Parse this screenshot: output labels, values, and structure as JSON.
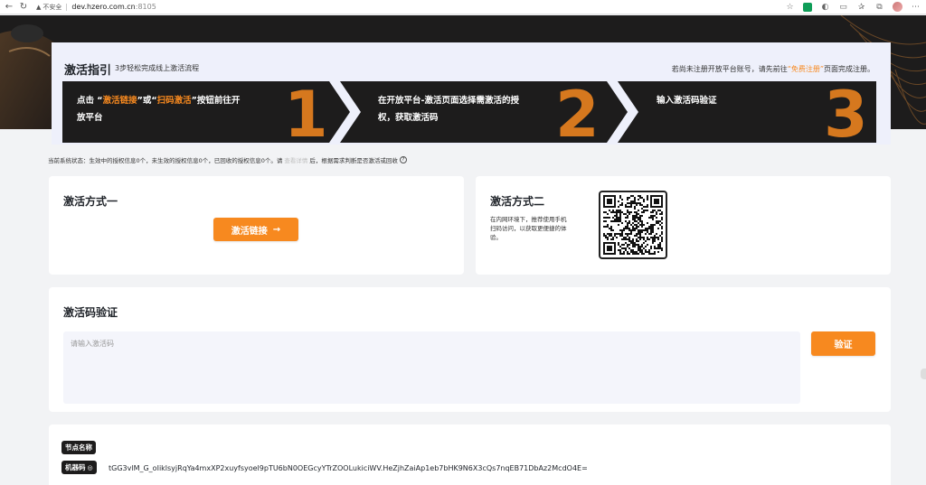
{
  "browser": {
    "security_label": "不安全",
    "url_host": "dev.hzero.com.cn",
    "url_port": ":8105"
  },
  "guide": {
    "title": "激活指引",
    "subtitle": "3步轻松完成线上激活流程",
    "right_prefix": "若尚未注册开放平台账号，请先前往",
    "right_link": "“免费注册”",
    "right_suffix": "页面完成注册。",
    "steps": [
      {
        "pre": "点击 “",
        "hl1": "激活链接",
        "mid": "”或“",
        "hl2": "扫码激活",
        "post": "”按钮前往开",
        "line2": "放平台",
        "number": "1"
      },
      {
        "line1": "在开放平台-激活页面选择需激活的授",
        "line2": "权，获取激活码",
        "number": "2"
      },
      {
        "line1": "输入激活码验证",
        "number": "3"
      }
    ]
  },
  "status": {
    "prefix": "当前系统状态：生效中的授权信息0个，未生效的授权信息0个，已回收的授权信息0个。请",
    "link": "查看详情",
    "suffix": "后，根据需求判断是否激活或回收"
  },
  "method1": {
    "title": "激活方式一",
    "button": "激活链接",
    "button_arrow": "→"
  },
  "method2": {
    "title": "激活方式二",
    "desc_line1": "在内网环境下，推荐使用手机",
    "desc_line2": "扫码访问，以获取更便捷的体",
    "desc_line3": "验。"
  },
  "verify": {
    "title": "激活码验证",
    "placeholder": "请输入激活码",
    "button": "验证"
  },
  "node": {
    "node_label": "节点名称",
    "machine_label": "机器码",
    "machine_code": "tGG3vlM_G_oIiklsyjRqYa4mxXP2xuyfsyoel9pTU6bN0OEGcyYTrZOOLukiciWV.HeZjhZaiAp1eb7bHK9N6X3cQs7nqEB71DbAz2McdO4E="
  },
  "colors": {
    "accent": "#f7891f",
    "dark": "#1d1c1c",
    "card_bg": "#eef0fb"
  }
}
